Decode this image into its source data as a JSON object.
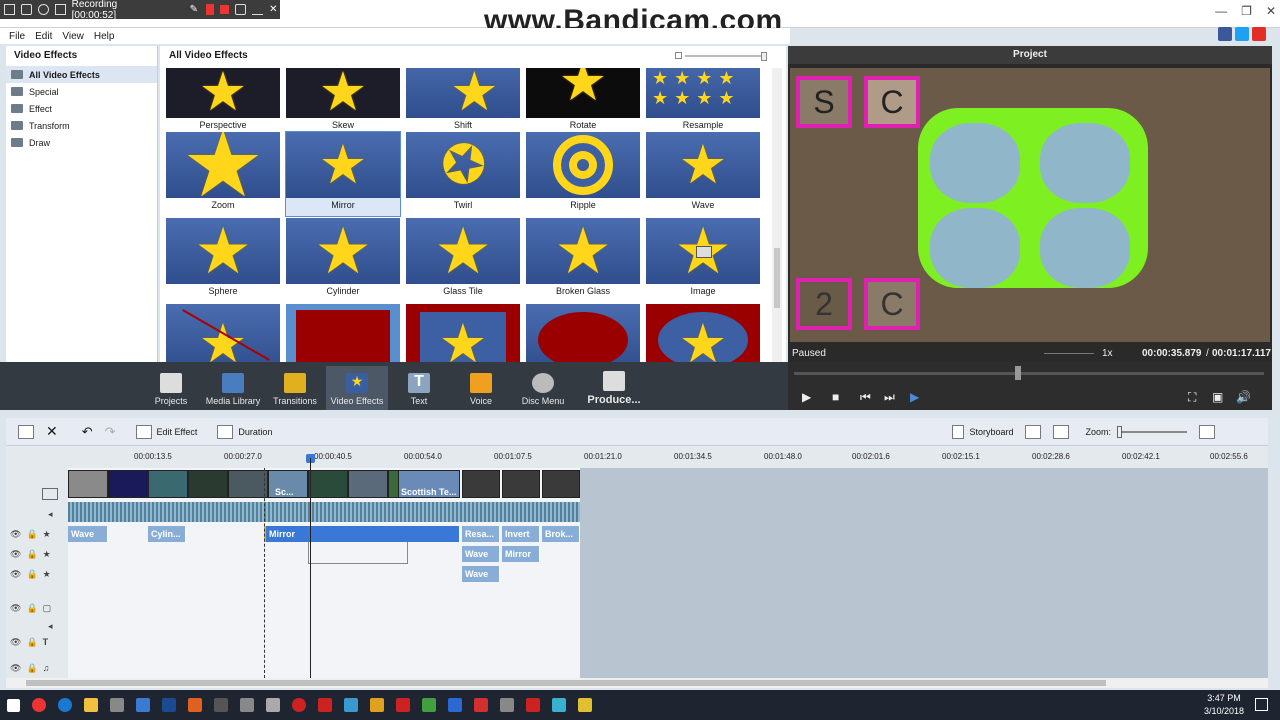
{
  "recorder": {
    "label": "Recording [00:00:52]"
  },
  "watermark": {
    "text": "www.Bandicam.com"
  },
  "menu": {
    "items": [
      "File",
      "Edit",
      "View",
      "Help"
    ]
  },
  "left_panel": {
    "title": "Video Effects",
    "items": [
      "All Video Effects",
      "Special",
      "Effect",
      "Transform",
      "Draw"
    ]
  },
  "effects_panel": {
    "title": "All Video Effects",
    "tiles": [
      "Perspective",
      "Skew",
      "Shift",
      "Rotate",
      "Resample",
      "Zoom",
      "Mirror",
      "Twirl",
      "Ripple",
      "Wave",
      "Sphere",
      "Cylinder",
      "Glass Tile",
      "Broken Glass",
      "Image"
    ],
    "selected": "Mirror"
  },
  "preview": {
    "title": "Project",
    "status": "Paused",
    "speed": "1x",
    "current_time": "00:00:35.879",
    "separator": "/",
    "total_time": "00:01:17.117",
    "letters": [
      "S",
      "C",
      "2",
      "C"
    ],
    "seek_fraction": 0.47
  },
  "ribbon": {
    "items": [
      "Projects",
      "Media Library",
      "Transitions",
      "Video Effects",
      "Text",
      "Voice",
      "Disc Menu",
      "Produce..."
    ],
    "active": "Video Effects"
  },
  "toolbar": {
    "edit_effect": "Edit Effect",
    "duration": "Duration",
    "storyboard": "Storyboard",
    "zoom_label": "Zoom:"
  },
  "timeline": {
    "ruler": [
      "00:00:13.5",
      "00:00:27.0",
      "00:00:40.5",
      "00:00:54.0",
      "00:01:07.5",
      "00:01:21.0",
      "00:01:34.5",
      "00:01:48.0",
      "00:02:01.6",
      "00:02:15.1",
      "00:02:28.6",
      "00:02:42.1",
      "00:02:55.6"
    ],
    "video_clip_label": "Scottish Te...",
    "video_clip_label_short": "Sc...",
    "fx_row1": [
      "Wave",
      "Cylin...",
      "Mirror",
      "Resa...",
      "Invert",
      "Brok..."
    ],
    "fx_row2": [
      "Wave",
      "Mirror"
    ],
    "fx_row3": [
      "Wave"
    ]
  },
  "taskbar": {
    "time": "3:47 PM",
    "date": "3/10/2018"
  }
}
